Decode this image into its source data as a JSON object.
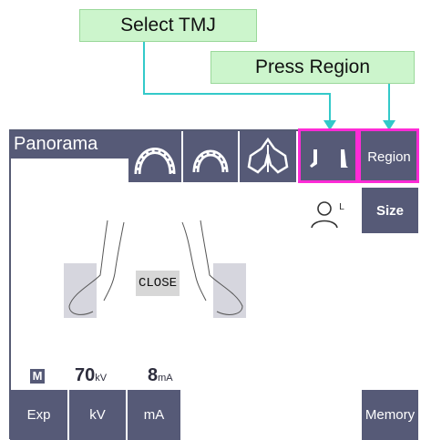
{
  "callouts": {
    "select_tmj": "Select TMJ",
    "press_region": "Press Region"
  },
  "header": {
    "title": "Panorama"
  },
  "buttons": {
    "region": "Region",
    "size": "Size",
    "exp": "Exp",
    "kv": "kV",
    "ma": "mA",
    "memory": "Memory"
  },
  "status": {
    "close": "CLOSE"
  },
  "settings": {
    "mode": "M",
    "kv_value": "70",
    "kv_unit": "kV",
    "ma_value": "8",
    "ma_unit": "mA"
  },
  "colors": {
    "panel_button": "#565a77",
    "callout_fill": "#ccf5cc",
    "arrow": "#33c9c9",
    "highlight": "#ff2bd6"
  }
}
